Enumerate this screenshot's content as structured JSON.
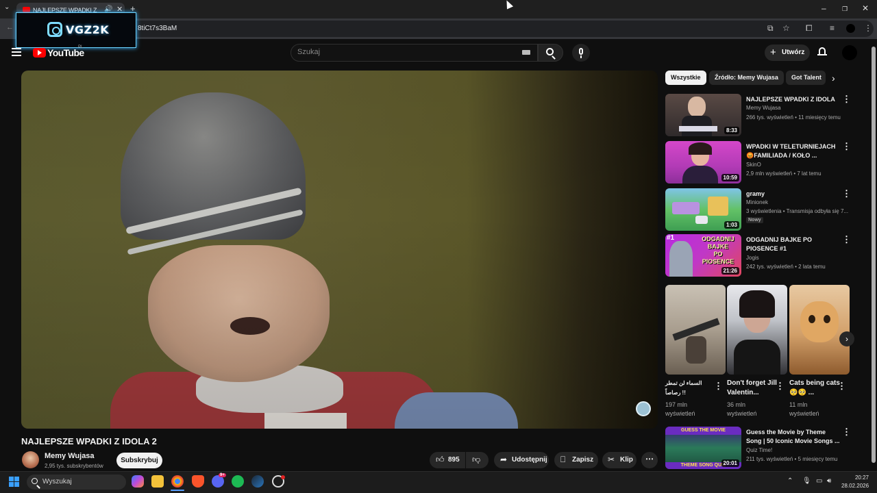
{
  "browser": {
    "tab_title": "NAJLEPSZE WPADKI Z IDOLA",
    "url_fragment": "8tiCt7s3BaM",
    "overlay_logo": "VGZ2K"
  },
  "header": {
    "logo_text": "YouTube",
    "country_code": "PL",
    "search_placeholder": "Szukaj",
    "create_label": "Utwórz"
  },
  "video": {
    "title": "NAJLEPSZE WPADKI Z IDOLA 2",
    "channel": "Memy Wujasa",
    "subscribers": "2,95 tys. subskrybentów",
    "subscribe_label": "Subskrybuj",
    "likes": "895",
    "share_label": "Udostępnij",
    "save_label": "Zapisz",
    "clip_label": "Klip"
  },
  "chips": [
    "Wszystkie",
    "Źródło: Memy Wujasa",
    "Got Talent"
  ],
  "recommendations": [
    {
      "title": "NAJLEPSZE WPADKI Z IDOLA",
      "channel": "Memy Wujasa",
      "meta": "266 tys. wyświetleń • 11 miesięcy temu",
      "duration": "8:33",
      "badge": ""
    },
    {
      "title": "WPADKI W TELETURNIEJACH 😡FAMILIADA / KOŁO ...",
      "channel": "SkinO",
      "meta": "2,9 mln wyświetleń • 7 lat temu",
      "duration": "10:59",
      "badge": ""
    },
    {
      "title": "gramy",
      "channel": "Minionek",
      "meta": "3 wyświetlenia • Transmisja odbyła się 7...",
      "duration": "1:03",
      "badge": "Nowy"
    },
    {
      "title": "ODGADNIJ BAJKE PO PIOSENCE #1",
      "channel": "Jogis",
      "meta": "242 tys. wyświetleń • 2 lata temu",
      "duration": "21:26",
      "badge": ""
    },
    {
      "title": "Guess the Movie by Theme Song | 50 Iconic Movie Songs ...",
      "channel": "Quiz Time!",
      "meta": "211 tys. wyświetleń • 5 miesięcy temu",
      "duration": "20:01",
      "badge": ""
    }
  ],
  "thumb_texts": {
    "rec4_top": "#1",
    "rec4_lines": [
      "ODGADNIJ",
      "BAJKE",
      "PO",
      "PIOSENCE"
    ],
    "rec5_top": "GUESS THE MOVIE",
    "rec5_bottom": "THEME SONG QUIZ"
  },
  "shorts": [
    {
      "title": "السماء لن تمطر رصاصاً !!",
      "views": "197 mln",
      "views_label": "wyświetleń"
    },
    {
      "title": "Don't forget Jill Valentin...",
      "views": "36 mln",
      "views_label": "wyświetleń"
    },
    {
      "title": "Cats being cats 🥺🥺 ...",
      "views": "11 mln",
      "views_label": "wyświetleń"
    }
  ],
  "taskbar": {
    "search_label": "Wyszukaj",
    "time": "20:27",
    "date": "28.02.2026",
    "badge_count": "9+"
  },
  "colors": {
    "background": "#0f0f0f",
    "accent": "#ff0000",
    "chip_active_bg": "#f1f1f1"
  }
}
